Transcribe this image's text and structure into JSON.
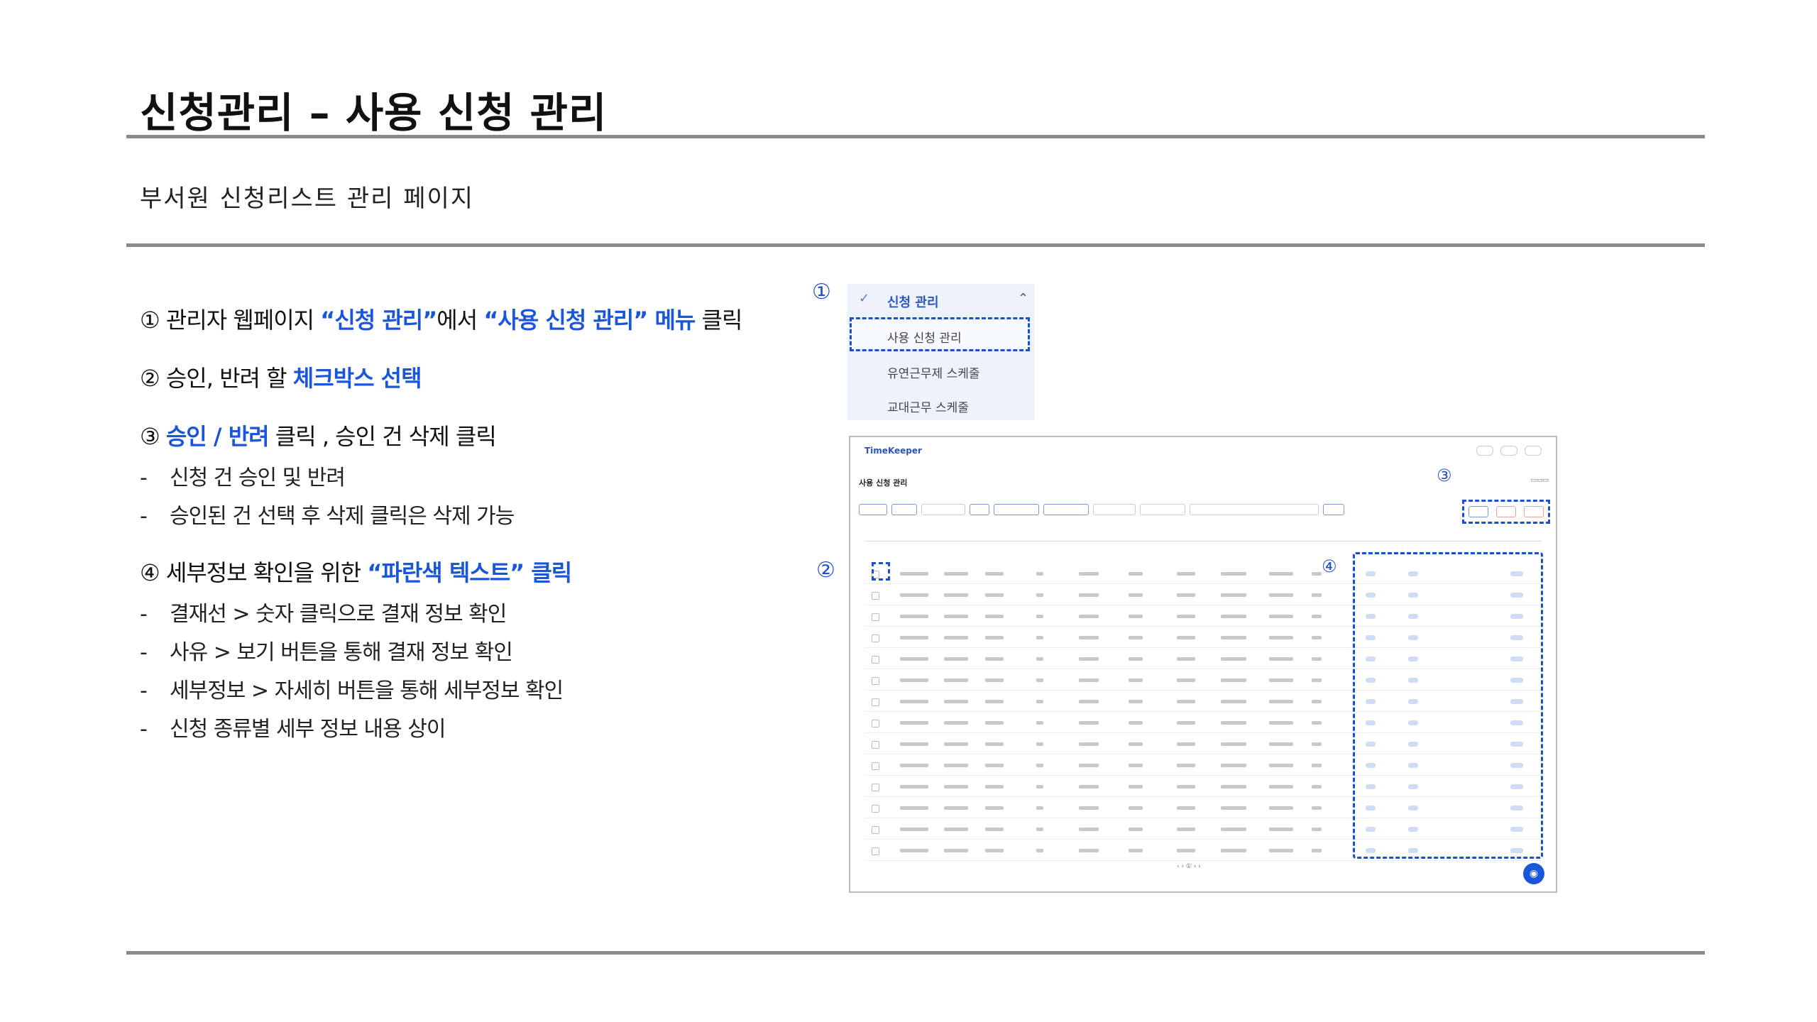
{
  "title": "신청관리 – 사용 신청 관리",
  "subtitle": "부서원 신청리스트 관리 페이지",
  "steps": [
    {
      "prefix": "① 관리자 웹페이지 ",
      "hl1": "“신청 관리”",
      "mid": "에서 ",
      "hl2": "“사용 신청 관리” 메뉴",
      "suffix": " 클릭"
    },
    {
      "prefix": "② 승인, 반려 할 ",
      "hl1": "체크박스 선택",
      "mid": "",
      "hl2": "",
      "suffix": ""
    },
    {
      "prefix": "③ ",
      "hl1": "승인 / 반려",
      "mid": " 클릭 , 승인 건 삭제 클릭",
      "hl2": "",
      "suffix": ""
    },
    {
      "prefix": "④ 세부정보 확인을 위한 ",
      "hl1": "“파란색 텍스트” 클릭",
      "mid": "",
      "hl2": "",
      "suffix": ""
    }
  ],
  "bullets3": [
    "신청 건 승인 및 반려",
    "승인된 건 선택 후 삭제 클릭은 삭제 가능"
  ],
  "bullets4": [
    "결재선 > 숫자 클릭으로 결재 정보 확인",
    "사유 > 보기 버튼을 통해 결재 정보 확인",
    "세부정보 > 자세히 버튼을 통해 세부정보 확인",
    "신청 종류별 세부 정보 내용 상이"
  ],
  "markers": {
    "m1": "①",
    "m2": "②",
    "m3": "③",
    "m4": "④"
  },
  "menu": {
    "head": "신청 관리",
    "items": [
      "사용 신청 관리",
      "유연근무제 스케줄",
      "교대근무 스케줄"
    ]
  },
  "app": {
    "logo": "TimeKeeper",
    "page_title": "사용 신청 관리"
  },
  "icons": {
    "menu_icon": "menu-icon",
    "chevron": "chevron-up-icon",
    "chat": "chat-icon"
  }
}
